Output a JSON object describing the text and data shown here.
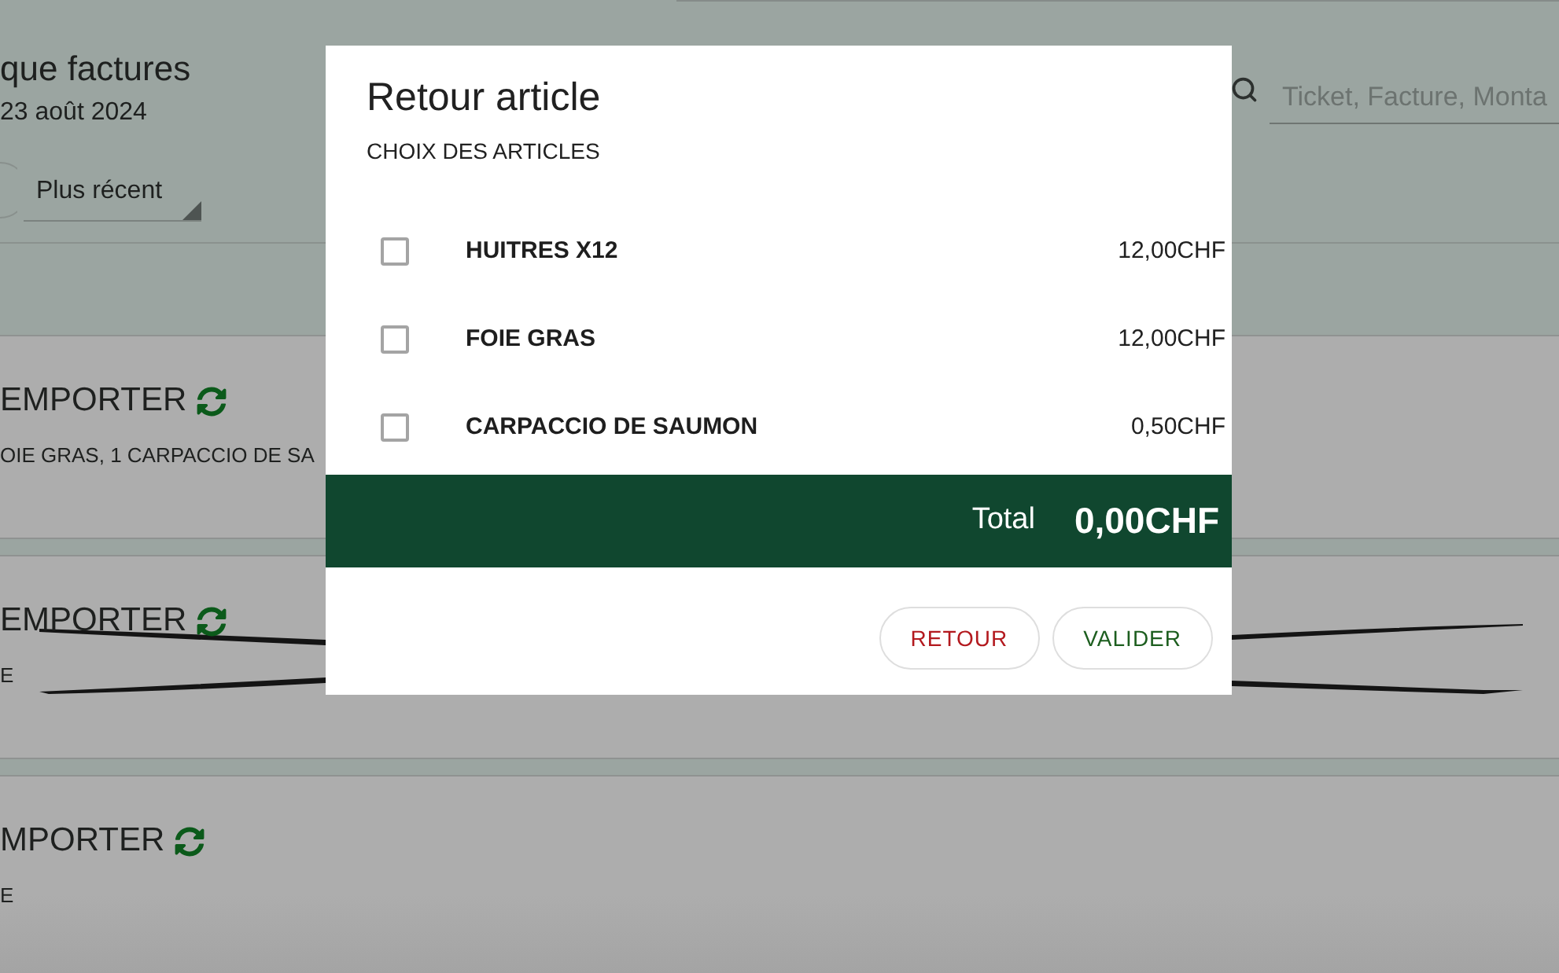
{
  "background": {
    "header": {
      "title": "que factures",
      "date": "23 août 2024",
      "sort": {
        "value": "Plus récent"
      },
      "search": {
        "placeholder": "Ticket, Facture, Monta"
      }
    },
    "orders": [
      {
        "title": "EMPORTER",
        "items": "OIE GRAS, 1 CARPACCIO DE SA",
        "struck": false
      },
      {
        "title": "EMPORTER",
        "items": "E",
        "struck": true
      },
      {
        "title": "MPORTER",
        "items": "E",
        "struck": false
      }
    ]
  },
  "dialog": {
    "title": "Retour article",
    "subtitle": "CHOIX DES ARTICLES",
    "items": [
      {
        "name": "HUITRES X12",
        "price": "12,00CHF",
        "checked": false
      },
      {
        "name": "FOIE GRAS",
        "price": "12,00CHF",
        "checked": false
      },
      {
        "name": "CARPACCIO DE SAUMON",
        "price": "0,50CHF",
        "checked": false
      }
    ],
    "total": {
      "label": "Total",
      "amount": "0,00CHF"
    },
    "buttons": [
      {
        "label": "RETOUR",
        "kind": "cancel"
      },
      {
        "label": "VALIDER",
        "kind": "confirm"
      }
    ]
  }
}
